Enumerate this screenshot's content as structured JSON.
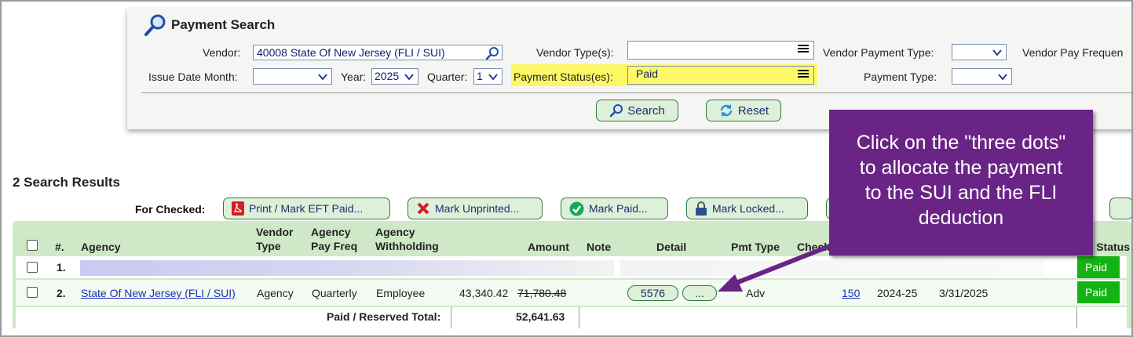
{
  "search_panel": {
    "title": "Payment Search",
    "vendor_label": "Vendor:",
    "vendor_value": "40008 State Of New Jersey (FLI / SUI)",
    "vendor_types_label": "Vendor Type(s):",
    "vendor_types_value": "",
    "vendor_payment_type_label": "Vendor Payment Type:",
    "vendor_payment_type_value": "",
    "vendor_pay_frequency_label": "Vendor Pay Frequen",
    "issue_date_month_label": "Issue Date Month:",
    "issue_date_month_value": "",
    "year_label": "Year:",
    "year_value": "2025",
    "quarter_label": "Quarter:",
    "quarter_value": "1",
    "payment_status_label": "Payment Status(es):",
    "payment_status_value": "Paid",
    "payment_type_label": "Payment Type:",
    "payment_type_value": "",
    "search_button": "Search",
    "reset_button": "Reset",
    "highlight_color": "#fff866"
  },
  "results": {
    "title": "2 Search Results",
    "for_checked_label": "For Checked:",
    "actions": {
      "print": "Print / Mark EFT Paid...",
      "unprinted": "Mark Unprinted...",
      "paid": "Mark Paid...",
      "locked": "Mark Locked..."
    },
    "columns": {
      "num": "#.",
      "agency": "Agency",
      "vendor_type_1": "Vendor",
      "vendor_type_2": "Type",
      "agency_pay_freq_1": "Agency",
      "agency_pay_freq_2": "Pay Freq",
      "agency_withholding_1": "Agency",
      "agency_withholding_2": "Withholding",
      "amount": "Amount",
      "note": "Note",
      "detail": "Detail",
      "pmt_type": "Pmt Type",
      "check": "Check",
      "status": "Status"
    },
    "rows": [
      {
        "num": "1.",
        "status": "Paid"
      },
      {
        "num": "2.",
        "agency": "State Of New Jersey (FLI / SUI)",
        "vendor_type": "Agency",
        "agency_pay_freq": "Quarterly",
        "agency_withholding": "Employee",
        "amount": "43,340.42",
        "amount_struck": "71,780.48",
        "detail_id": "5576",
        "detail_more": "...",
        "pmt_type": "Adv",
        "check": "150",
        "fiscal_year": "2024-25",
        "date": "3/31/2025",
        "status": "Paid"
      }
    ],
    "total_label": "Paid / Reserved Total:",
    "total_value": "52,641.63",
    "status_color": "#13b313"
  },
  "callout": {
    "line1": "Click on the \"three dots\"",
    "line2": "to allocate the payment",
    "line3": "to the SUI and the FLI",
    "line4": "deduction",
    "color": "#6a2485"
  }
}
